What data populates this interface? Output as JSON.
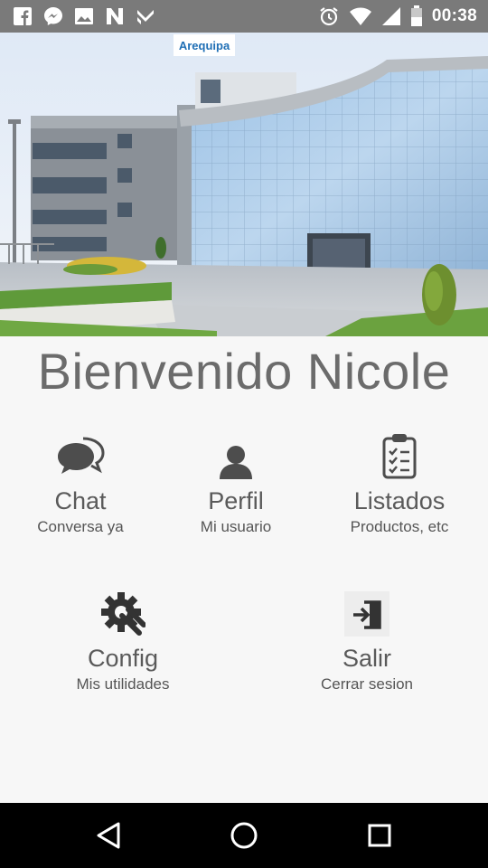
{
  "status_bar": {
    "time": "00:38",
    "left_icons": [
      "facebook-icon",
      "messenger-icon",
      "gallery-icon",
      "n-app-icon",
      "check-app-icon"
    ],
    "right_icons": [
      "alarm-icon",
      "wifi-icon",
      "signal-icon",
      "battery-icon"
    ]
  },
  "hero": {
    "sign_text": "Arequipa"
  },
  "welcome": {
    "text": "Bienvenido Nicole"
  },
  "menu": {
    "chat": {
      "title": "Chat",
      "subtitle": "Conversa ya",
      "icon": "chat-bubbles-icon"
    },
    "perfil": {
      "title": "Perfil",
      "subtitle": "Mi usuario",
      "icon": "user-icon"
    },
    "listados": {
      "title": "Listados",
      "subtitle": "Productos, etc",
      "icon": "clipboard-list-icon"
    },
    "config": {
      "title": "Config",
      "subtitle": "Mis utilidades",
      "icon": "gear-wrench-icon"
    },
    "salir": {
      "title": "Salir",
      "subtitle": "Cerrar sesion",
      "icon": "logout-icon"
    }
  },
  "nav_bar": {
    "buttons": [
      "back-icon",
      "home-icon",
      "recents-icon"
    ]
  },
  "colors": {
    "status_bar_bg": "#7a7a7a",
    "page_bg": "#f7f7f7",
    "text_gray": "#5a5a5a",
    "nav_bar_bg": "#000000"
  }
}
